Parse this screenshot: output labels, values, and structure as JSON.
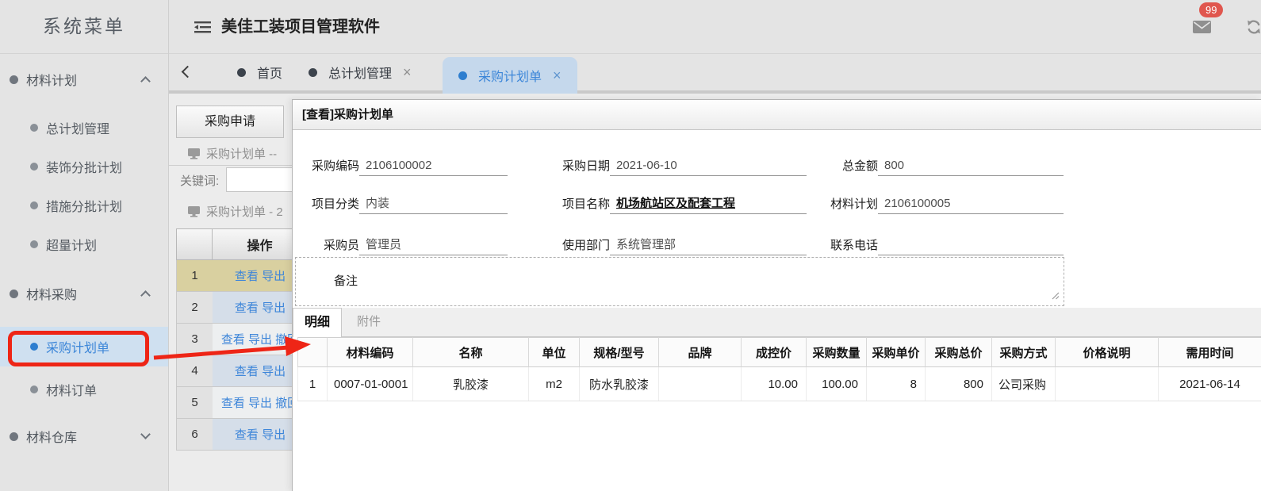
{
  "colors": {
    "accent_blue": "#3c86d8",
    "selected_bg": "#cfe0f0",
    "active_tab_bg": "#c5d8ec",
    "badge_red": "#e0564e",
    "annotation_red": "#ee2516",
    "row_tan": "#d9d0a0",
    "row_blue": "#d5dee9"
  },
  "icons": {
    "close": "×",
    "back_chevron": "<",
    "collapse_menu": "menu-fold",
    "mail": "envelope",
    "refresh": "circular-arrows",
    "monitor": "screen",
    "bullet": "dot",
    "resize_handle": "diagonal-grip"
  },
  "header": {
    "sidebar_title": "系统菜单",
    "app_title": "美佳工装项目管理软件",
    "badge_count": "99"
  },
  "sidebar": {
    "items": [
      {
        "label": "材料计划",
        "type": "group",
        "chevron": "up"
      },
      {
        "label": "总计划管理",
        "type": "child"
      },
      {
        "label": "装饰分批计划",
        "type": "child"
      },
      {
        "label": "措施分批计划",
        "type": "child"
      },
      {
        "label": "超量计划",
        "type": "child"
      },
      {
        "label": "材料采购",
        "type": "group",
        "chevron": "up"
      },
      {
        "label": "采购计划单",
        "type": "child",
        "selected": true
      },
      {
        "label": "材料订单",
        "type": "child"
      },
      {
        "label": "材料仓库",
        "type": "group",
        "chevron": "down"
      }
    ]
  },
  "tabbar": {
    "tabs": [
      {
        "label": "首页",
        "closable": false,
        "active": false
      },
      {
        "label": "总计划管理",
        "closable": true,
        "active": false
      },
      {
        "label": "采购计划单",
        "closable": true,
        "active": true
      }
    ]
  },
  "background": {
    "apply_button": "采购申请",
    "caption1": "采购计划单 --",
    "keyword_label": "关键词:",
    "caption2": "采购计划单 - 2",
    "op_header": "操作",
    "rows": [
      {
        "num": "1",
        "ops": "查看 导出"
      },
      {
        "num": "2",
        "ops": "查看 导出"
      },
      {
        "num": "3",
        "ops": "查看 导出 撤回"
      },
      {
        "num": "4",
        "ops": "查看 导出"
      },
      {
        "num": "5",
        "ops": "查看 导出 撤回"
      },
      {
        "num": "6",
        "ops": "查看 导出"
      }
    ]
  },
  "modal": {
    "title": "[查看]采购计划单",
    "fields": [
      {
        "label": "采购编码",
        "value": "2106100002"
      },
      {
        "label": "采购日期",
        "value": "2021-06-10"
      },
      {
        "label": "总金额",
        "value": "800"
      },
      {
        "label": "项目分类",
        "value": "内装"
      },
      {
        "label": "项目名称",
        "value": "机场航站区及配套工程"
      },
      {
        "label": "材料计划",
        "value": "2106100005"
      },
      {
        "label": "采购员",
        "value": "管理员"
      },
      {
        "label": "使用部门",
        "value": "系统管理部"
      },
      {
        "label": "联系电话",
        "value": ""
      }
    ],
    "remark_label": "备注",
    "detail_tab": "明细",
    "attachment_tab": "附件",
    "table": {
      "headers": [
        "材料编码",
        "名称",
        "单位",
        "规格/型号",
        "品牌",
        "成控价",
        "采购数量",
        "采购单价",
        "采购总价",
        "采购方式",
        "价格说明",
        "需用时间"
      ],
      "rows": [
        {
          "num": "1",
          "cells": [
            "0007-01-0001",
            "乳胶漆",
            "m2",
            "防水乳胶漆",
            "",
            "10.00",
            "100.00",
            "8",
            "800",
            "公司采购",
            "",
            "2021-06-14"
          ]
        }
      ]
    }
  }
}
